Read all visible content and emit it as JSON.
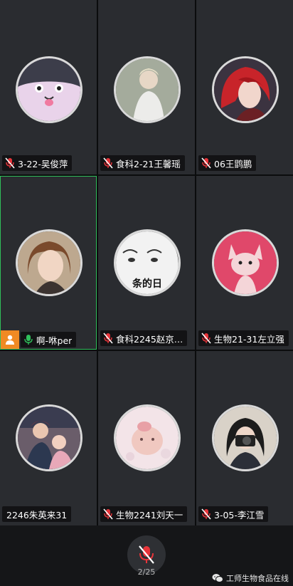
{
  "participants": [
    {
      "name": "3-22-吴俊萍",
      "muted": true,
      "mic_color": "#e8343a"
    },
    {
      "name": "食科2-21王馨瑶",
      "muted": true,
      "mic_color": "#e8343a"
    },
    {
      "name": "06王鹍鹏",
      "muted": true,
      "mic_color": "#e8343a"
    },
    {
      "name": "啊-咻per",
      "muted": false,
      "speaking": true,
      "host": true,
      "mic_color": "#2fbf5b"
    },
    {
      "name": "食科2245赵京…",
      "muted": true,
      "mic_color": "#e8343a"
    },
    {
      "name": "生物21-31左立强",
      "muted": true,
      "mic_color": "#e8343a"
    },
    {
      "name": "2246朱英来31",
      "muted": false,
      "mic_color": ""
    },
    {
      "name": "生物2241刘天一",
      "muted": true,
      "mic_color": "#e8343a"
    },
    {
      "name": "3-05-李江雪",
      "muted": true,
      "mic_color": "#e8343a"
    }
  ],
  "avatar_captions": {
    "p5": "条的日"
  },
  "bottom_bar": {
    "mute_icon": "microphone-muted-icon",
    "page_counter": "2/25"
  },
  "watermark": {
    "text": "工师生物食品在线",
    "icon": "wechat-icon"
  },
  "colors": {
    "active_border": "#2fbf5b",
    "host_badge": "#f08a24",
    "tile_bg": "#2a2c30"
  }
}
